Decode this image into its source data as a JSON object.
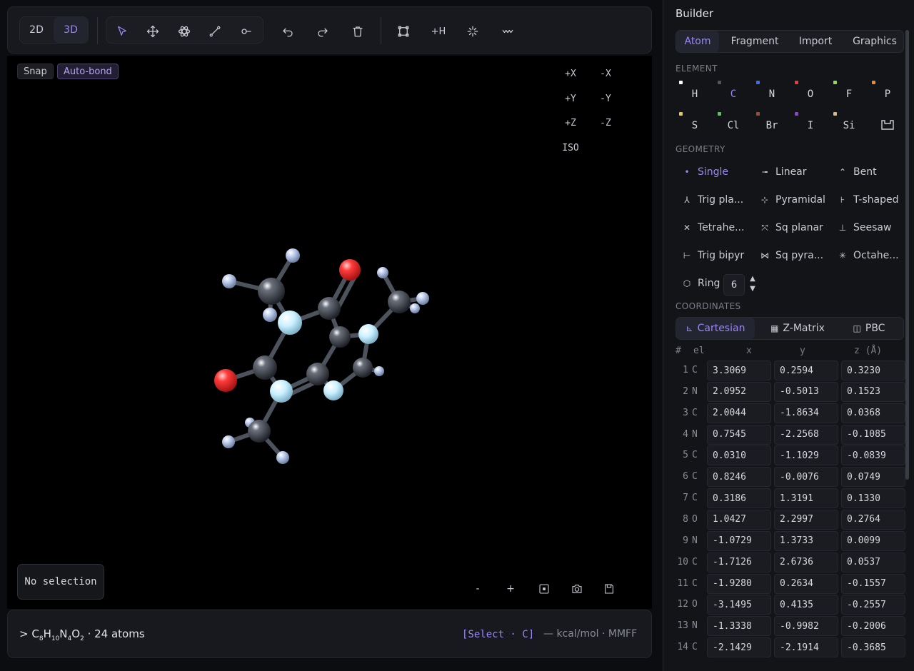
{
  "toolbar": {
    "mode_2d": "2D",
    "mode_3d": "3D",
    "add_h": "+H"
  },
  "viewport": {
    "chip_snap": "Snap",
    "chip_autobond": "Auto-bond",
    "axes": [
      "+X",
      "-X",
      "+Y",
      "-Y",
      "+Z",
      "-Z"
    ],
    "iso": "ISO",
    "no_selection": "No selection",
    "zoom_out": "-",
    "zoom_in": "+"
  },
  "status": {
    "prefix": "> ",
    "formula_parts": [
      "C",
      "8",
      "H",
      "10",
      "N",
      "4",
      "O",
      "2"
    ],
    "atoms": " · 24 atoms",
    "command": "[Select · C]",
    "energy": "— kcal/mol · MMFF"
  },
  "builder": {
    "title": "Builder",
    "tabs": [
      "Atom",
      "Fragment",
      "Import",
      "Graphics"
    ],
    "element_label": "ELEMENT",
    "elements": [
      {
        "sym": "H",
        "color": "#ffffff"
      },
      {
        "sym": "C",
        "color": "#555555"
      },
      {
        "sym": "N",
        "color": "#3b6cf5"
      },
      {
        "sym": "O",
        "color": "#ef3b3b"
      },
      {
        "sym": "F",
        "color": "#8fe04a"
      },
      {
        "sym": "P",
        "color": "#f08a2a"
      },
      {
        "sym": "S",
        "color": "#f3c83a"
      },
      {
        "sym": "Cl",
        "color": "#3fd25a"
      },
      {
        "sym": "Br",
        "color": "#a8472a"
      },
      {
        "sym": "I",
        "color": "#9a3ad4"
      },
      {
        "sym": "Si",
        "color": "#e0b87a"
      }
    ],
    "selected_element": "C",
    "geometry_label": "GEOMETRY",
    "geometries": [
      "Single",
      "Linear",
      "Bent",
      "Trig pla...",
      "Pyramidal",
      "T-shaped",
      "Tetrahe...",
      "Sq planar",
      "Seesaw",
      "Trig bipyr",
      "Sq pyra...",
      "Octahe..."
    ],
    "selected_geometry": "Single",
    "ring_label": "Ring",
    "ring_size": "6",
    "coordinates_label": "COORDINATES",
    "coord_tabs": [
      "Cartesian",
      "Z-Matrix",
      "PBC"
    ],
    "table_headers": [
      "#",
      "el",
      "x",
      "y",
      "z (Å)"
    ],
    "rows": [
      [
        "1",
        "C",
        "3.3069",
        "0.2594",
        "0.3230"
      ],
      [
        "2",
        "N",
        "2.0952",
        "-0.5013",
        "0.1523"
      ],
      [
        "3",
        "C",
        "2.0044",
        "-1.8634",
        "0.0368"
      ],
      [
        "4",
        "N",
        "0.7545",
        "-2.2568",
        "-0.1085"
      ],
      [
        "5",
        "C",
        "0.0310",
        "-1.1029",
        "-0.0839"
      ],
      [
        "6",
        "C",
        "0.8246",
        "-0.0076",
        "0.0749"
      ],
      [
        "7",
        "C",
        "0.3186",
        "1.3191",
        "0.1330"
      ],
      [
        "8",
        "O",
        "1.0427",
        "2.2997",
        "0.2764"
      ],
      [
        "9",
        "N",
        "-1.0729",
        "1.3733",
        "0.0099"
      ],
      [
        "10",
        "C",
        "-1.7126",
        "2.6736",
        "0.0537"
      ],
      [
        "11",
        "C",
        "-1.9280",
        "0.2634",
        "-0.1557"
      ],
      [
        "12",
        "O",
        "-3.1495",
        "0.4135",
        "-0.2557"
      ],
      [
        "13",
        "N",
        "-1.3338",
        "-0.9982",
        "-0.2006"
      ],
      [
        "14",
        "C",
        "-2.1429",
        "-2.1914",
        "-0.3685"
      ]
    ]
  },
  "colors": {
    "accent": "#9b87f5",
    "carbon": "#3a3f48",
    "nitrogen": "#c9f0ff",
    "oxygen": "#ff3b3b",
    "hydrogen": "#b8c8e8"
  }
}
